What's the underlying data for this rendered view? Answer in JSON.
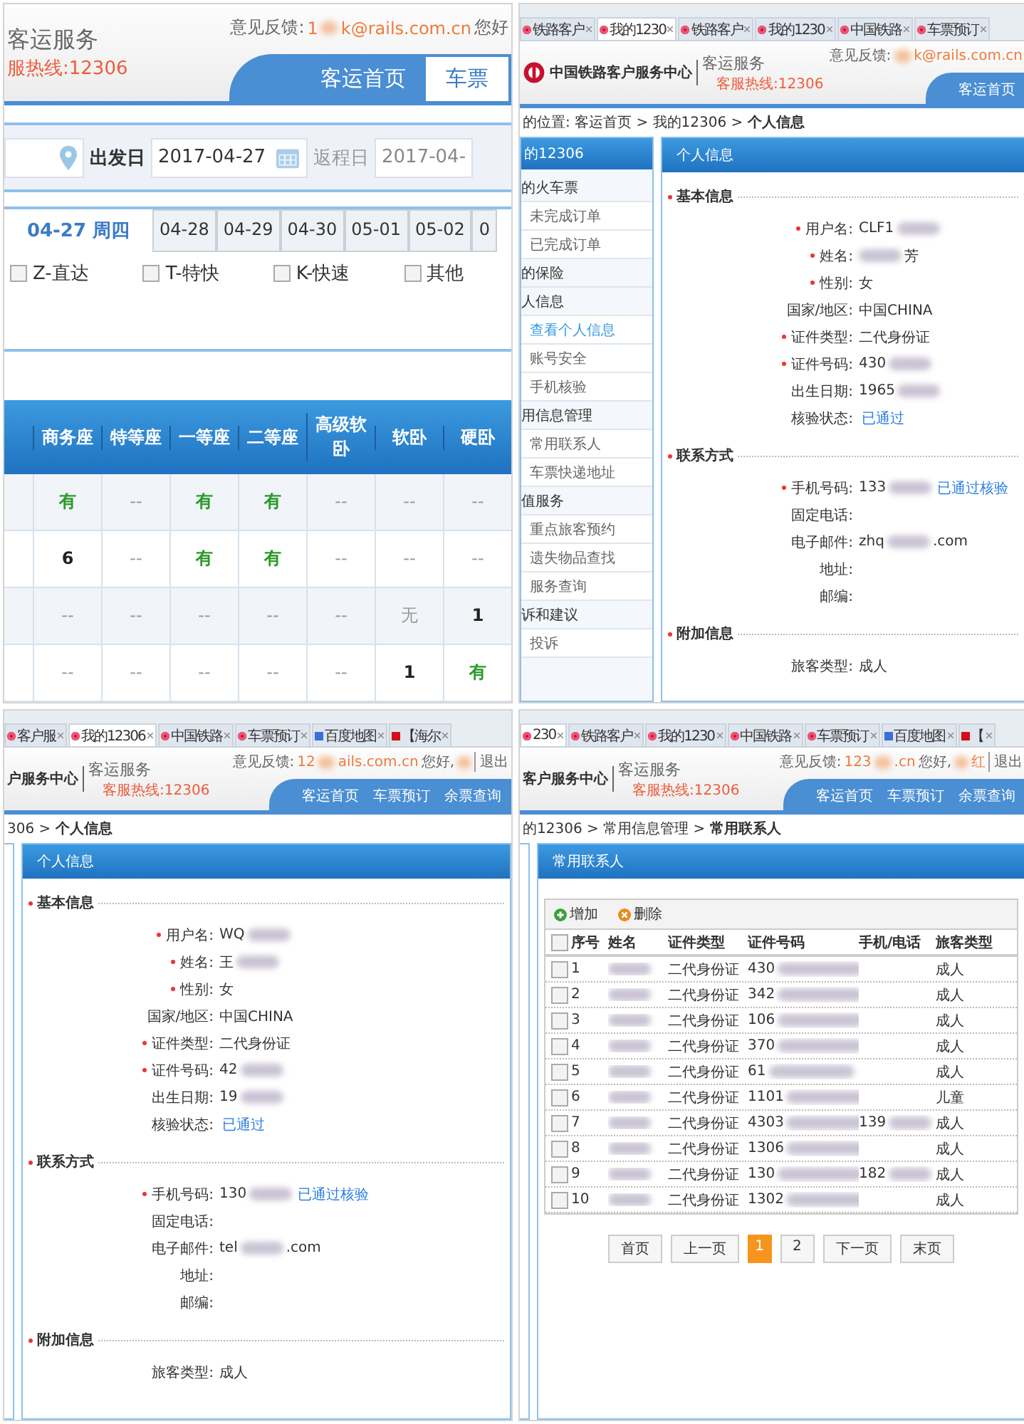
{
  "screenshots": [
    {
      "kind": "search",
      "header": {
        "service": "客运服务",
        "hotline": "服热线:12306",
        "feedback_label": "意见反馈:",
        "email_start": "1",
        "email_end": "k@rails.com.cn",
        "greeting": "您好",
        "nav": [
          {
            "label": "客运首页",
            "selected": false
          },
          {
            "label": "车票",
            "selected": true
          }
        ]
      },
      "search": {
        "date_label": "出发日",
        "date": "2017-04-27",
        "return_label": "返程日",
        "return_date": "2017-04-"
      },
      "date_tabs": [
        {
          "label": "04-27 周四",
          "selected": true
        },
        {
          "label": "04-28",
          "selected": false
        },
        {
          "label": "04-29",
          "selected": false
        },
        {
          "label": "04-30",
          "selected": false
        },
        {
          "label": "05-01",
          "selected": false
        },
        {
          "label": "05-02",
          "selected": false
        },
        {
          "label": "0",
          "selected": false
        }
      ],
      "filters": [
        {
          "label": "Z-直达",
          "checked": false
        },
        {
          "label": "T-特快",
          "checked": false
        },
        {
          "label": "K-快速",
          "checked": false
        },
        {
          "label": "其他",
          "checked": false
        }
      ],
      "seat_table": {
        "columns": [
          "商务座",
          "特等座",
          "一等座",
          "二等座",
          "高级软卧",
          "软卧",
          "硬卧"
        ],
        "rows": [
          [
            {
              "text": "有",
              "kind": "available"
            },
            {
              "text": "--",
              "kind": "none"
            },
            {
              "text": "有",
              "kind": "available"
            },
            {
              "text": "有",
              "kind": "available"
            },
            {
              "text": "--",
              "kind": "none"
            },
            {
              "text": "--",
              "kind": "none"
            },
            {
              "text": "--",
              "kind": "none"
            }
          ],
          [
            {
              "text": "6",
              "kind": "count"
            },
            {
              "text": "--",
              "kind": "none"
            },
            {
              "text": "有",
              "kind": "available"
            },
            {
              "text": "有",
              "kind": "available"
            },
            {
              "text": "--",
              "kind": "none"
            },
            {
              "text": "--",
              "kind": "none"
            },
            {
              "text": "--",
              "kind": "none"
            }
          ],
          [
            {
              "text": "--",
              "kind": "none"
            },
            {
              "text": "--",
              "kind": "none"
            },
            {
              "text": "--",
              "kind": "none"
            },
            {
              "text": "--",
              "kind": "none"
            },
            {
              "text": "--",
              "kind": "none"
            },
            {
              "text": "无",
              "kind": "soldout"
            },
            {
              "text": "1",
              "kind": "count"
            }
          ],
          [
            {
              "text": "--",
              "kind": "none"
            },
            {
              "text": "--",
              "kind": "none"
            },
            {
              "text": "--",
              "kind": "none"
            },
            {
              "text": "--",
              "kind": "none"
            },
            {
              "text": "--",
              "kind": "none"
            },
            {
              "text": "1",
              "kind": "count"
            },
            {
              "text": "有",
              "kind": "available"
            }
          ]
        ]
      }
    },
    {
      "kind": "profile",
      "tabs": [
        {
          "label": "铁路客户",
          "kind": "rail",
          "selected": false
        },
        {
          "label": "我的1230",
          "kind": "rail",
          "selected": true
        },
        {
          "label": "铁路客户",
          "kind": "rail",
          "selected": false
        },
        {
          "label": "我的1230",
          "kind": "rail",
          "selected": false
        },
        {
          "label": "中国铁路",
          "kind": "rail",
          "selected": false
        },
        {
          "label": "车票预订",
          "kind": "rail",
          "selected": false
        }
      ],
      "header": {
        "title": "中国铁路客户服务中心",
        "service": "客运服务",
        "hotline": "客服热线:12306",
        "feedback_label": "意见反馈:",
        "email_end": "k@rails.com.cn",
        "nav": [
          {
            "label": "客运首页",
            "selected": false
          }
        ]
      },
      "breadcrumb": "的位置: 客运首页 > 我的12306 > **个人信息**",
      "sidebar": {
        "title": "的12306",
        "groups": [
          {
            "label": "的火车票",
            "children": [
              {
                "label": "未完成订单",
                "selected": false
              },
              {
                "label": "已完成订单",
                "selected": false
              }
            ]
          },
          {
            "label": "的保险"
          },
          {
            "label": "人信息",
            "children": [
              {
                "label": "查看个人信息",
                "selected": true
              },
              {
                "label": "账号安全",
                "selected": false
              },
              {
                "label": "手机核验",
                "selected": false
              }
            ]
          },
          {
            "label": "用信息管理",
            "children": [
              {
                "label": "常用联系人",
                "selected": false
              },
              {
                "label": "车票快递地址",
                "selected": false
              }
            ]
          },
          {
            "label": "值服务",
            "children": [
              {
                "label": "重点旅客预约",
                "selected": false
              },
              {
                "label": "遗失物品查找",
                "selected": false
              },
              {
                "label": "服务查询",
                "selected": false
              }
            ]
          },
          {
            "label": "诉和建议",
            "children": [
              {
                "label": "投诉",
                "selected": false
              }
            ]
          }
        ]
      },
      "info": {
        "title": "个人信息",
        "sections": [
          {
            "title": "基本信息",
            "rows": [
              {
                "label": "用户名:",
                "required": true,
                "value": "CLF1",
                "redacted": true
              },
              {
                "label": "姓名:",
                "required": true,
                "value": "芳",
                "redacted": true,
                "redact_first": true
              },
              {
                "label": "性别:",
                "required": true,
                "value": "女"
              },
              {
                "label": "国家/地区:",
                "required": false,
                "value": "中国CHINA"
              },
              {
                "label": "证件类型:",
                "required": true,
                "value": "二代身份证"
              },
              {
                "label": "证件号码:",
                "required": true,
                "value": "430",
                "redacted": true
              },
              {
                "label": "出生日期:",
                "required": false,
                "value": "1965",
                "redacted": true
              },
              {
                "label": "核验状态:",
                "required": false,
                "link": "已通过"
              }
            ]
          },
          {
            "title": "联系方式",
            "rows": [
              {
                "label": "手机号码:",
                "required": true,
                "value": "133",
                "redacted": true,
                "link": "已通过核验"
              },
              {
                "label": "固定电话:",
                "required": false
              },
              {
                "label": "电子邮件:",
                "required": false,
                "value": "zhq",
                "redacted": true,
                "value_end": ".com"
              },
              {
                "label": "地址:",
                "required": false
              },
              {
                "label": "邮编:",
                "required": false
              }
            ]
          },
          {
            "title": "附加信息",
            "rows": [
              {
                "label": "旅客类型:",
                "required": false,
                "value": "成人"
              }
            ]
          }
        ]
      }
    },
    {
      "kind": "profile",
      "tabs": [
        {
          "label": "客户服",
          "kind": "rail",
          "selected": false
        },
        {
          "label": "我的12306",
          "kind": "rail",
          "selected": true
        },
        {
          "label": "中国铁路",
          "kind": "rail",
          "selected": false
        },
        {
          "label": "车票预订",
          "kind": "rail",
          "selected": false
        },
        {
          "label": "百度地图",
          "kind": "map",
          "selected": false
        },
        {
          "label": "【海尔",
          "kind": "shop",
          "selected": false
        }
      ],
      "header": {
        "title": "户服务中心",
        "service": "客运服务",
        "hotline": "客服热线:12306",
        "feedback_label": "意见反馈:",
        "email_start": "12",
        "email_end": "ails.com.cn",
        "greeting": "您好,",
        "logout": "退出",
        "nav": [
          {
            "label": "客运首页",
            "selected": false
          },
          {
            "label": "车票预订",
            "selected": false
          },
          {
            "label": "余票查询",
            "selected": false
          }
        ]
      },
      "breadcrumb": "306 > **个人信息**",
      "info": {
        "title": "个人信息",
        "sections": [
          {
            "title": "基本信息",
            "rows": [
              {
                "label": "用户名:",
                "required": true,
                "value": "WQ",
                "redacted": true
              },
              {
                "label": "姓名:",
                "required": true,
                "value": "王",
                "redacted": true
              },
              {
                "label": "性别:",
                "required": true,
                "value": "女"
              },
              {
                "label": "国家/地区:",
                "required": false,
                "value": "中国CHINA"
              },
              {
                "label": "证件类型:",
                "required": true,
                "value": "二代身份证"
              },
              {
                "label": "证件号码:",
                "required": true,
                "value": "42",
                "redacted": true
              },
              {
                "label": "出生日期:",
                "required": false,
                "value": "19",
                "redacted": true
              },
              {
                "label": "核验状态:",
                "required": false,
                "link": "已通过"
              }
            ]
          },
          {
            "title": "联系方式",
            "rows": [
              {
                "label": "手机号码:",
                "required": true,
                "value": "130",
                "redacted": true,
                "link": "已通过核验"
              },
              {
                "label": "固定电话:",
                "required": false
              },
              {
                "label": "电子邮件:",
                "required": false,
                "value": "tel",
                "redacted": true,
                "value_end": ".com"
              },
              {
                "label": "地址:",
                "required": false
              },
              {
                "label": "邮编:",
                "required": false
              }
            ]
          },
          {
            "title": "附加信息",
            "rows": [
              {
                "label": "旅客类型:",
                "required": false,
                "value": "成人"
              }
            ]
          }
        ]
      }
    },
    {
      "kind": "contacts",
      "tabs": [
        {
          "label": "230",
          "kind": "rail",
          "selected": true
        },
        {
          "label": "铁路客户",
          "kind": "rail",
          "selected": false
        },
        {
          "label": "我的1230",
          "kind": "rail",
          "selected": false
        },
        {
          "label": "中国铁路",
          "kind": "rail",
          "selected": false
        },
        {
          "label": "车票预订",
          "kind": "rail",
          "selected": false
        },
        {
          "label": "百度地图",
          "kind": "map",
          "selected": false
        },
        {
          "label": "【",
          "kind": "shop",
          "selected": false
        }
      ],
      "header": {
        "title": "客户服务中心",
        "service": "客运服务",
        "hotline": "客服热线:12306",
        "feedback_label": "意见反馈:",
        "email_start": "123",
        "email_end": ".cn",
        "greeting": "您好,",
        "user": "红",
        "logout": "退出",
        "nav": [
          {
            "label": "客运首页",
            "selected": false
          },
          {
            "label": "车票预订",
            "selected": false
          },
          {
            "label": "余票查询",
            "selected": false
          }
        ]
      },
      "breadcrumb": "的12306 > 常用信息管理 > **常用联系人**",
      "panel_title": "常用联系人",
      "toolbar": [
        {
          "label": "增加",
          "kind": "add"
        },
        {
          "label": "删除",
          "kind": "delete"
        }
      ],
      "table": {
        "select_all_checked": false,
        "columns": [
          "序号",
          "姓名",
          "证件类型",
          "证件号码",
          "手机/电话",
          "旅客类型"
        ],
        "rows": [
          {
            "checked": false,
            "no": "1",
            "id_type": "二代身份证",
            "id": "430",
            "type": "成人"
          },
          {
            "checked": false,
            "no": "2",
            "id_type": "二代身份证",
            "id": "342",
            "type": "成人"
          },
          {
            "checked": false,
            "no": "3",
            "id_type": "二代身份证",
            "id": "106",
            "type": "成人"
          },
          {
            "checked": false,
            "no": "4",
            "id_type": "二代身份证",
            "id": "370",
            "type": "成人"
          },
          {
            "checked": false,
            "no": "5",
            "id_type": "二代身份证",
            "id": "61",
            "type": "成人"
          },
          {
            "checked": false,
            "no": "6",
            "id_type": "二代身份证",
            "id": "1101",
            "type": "儿童"
          },
          {
            "checked": false,
            "no": "7",
            "id_type": "二代身份证",
            "id": "4303",
            "phone": "139",
            "type": "成人"
          },
          {
            "checked": false,
            "no": "8",
            "id_type": "二代身份证",
            "id": "1306",
            "type": "成人"
          },
          {
            "checked": false,
            "no": "9",
            "id_type": "二代身份证",
            "id": "130",
            "phone": "182",
            "type": "成人"
          },
          {
            "checked": false,
            "no": "10",
            "id_type": "二代身份证",
            "id": "1302",
            "type": "成人"
          }
        ]
      },
      "pagination": [
        {
          "label": "首页",
          "selected": false
        },
        {
          "label": "上一页",
          "selected": false
        },
        {
          "label": "1",
          "selected": true
        },
        {
          "label": "2",
          "selected": false
        },
        {
          "label": "下一页",
          "selected": false
        },
        {
          "label": "末页",
          "selected": false
        }
      ]
    }
  ]
}
